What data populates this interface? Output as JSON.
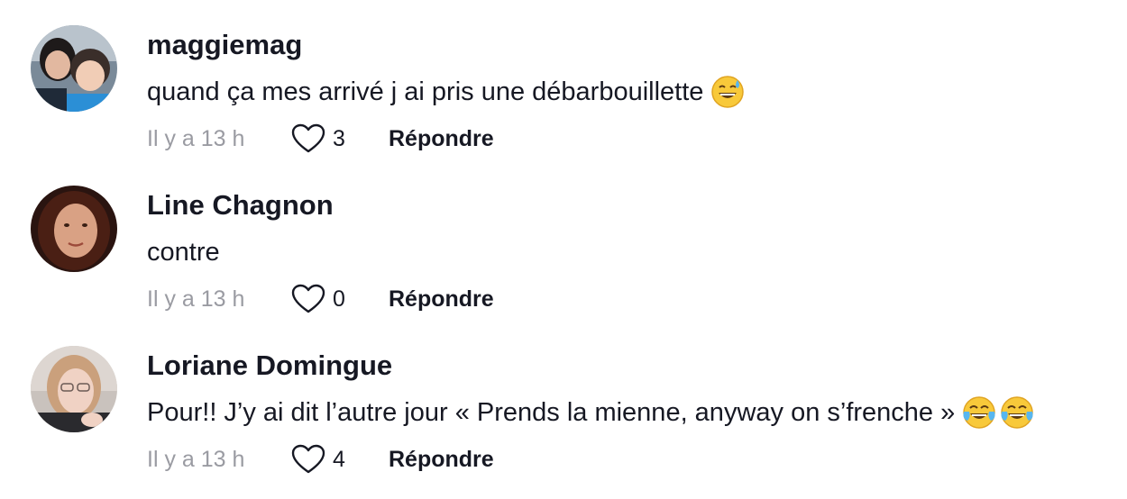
{
  "comments": [
    {
      "username": "maggiemag",
      "text": "quand ça mes arrivé j ai pris une débarbouillette",
      "emojis": [
        "grinning-sweat-emoji"
      ],
      "time": "Il y a 13 h",
      "likes": "3",
      "reply_label": "Répondre"
    },
    {
      "username": "Line Chagnon",
      "text": "contre",
      "emojis": [],
      "time": "Il y a 13 h",
      "likes": "0",
      "reply_label": "Répondre"
    },
    {
      "username": "Loriane Domingue",
      "text": "Pour!! J’y ai dit l’autre jour « Prends la mienne, anyway on s’frenche »",
      "emojis": [
        "tears-of-joy-emoji",
        "tears-of-joy-emoji"
      ],
      "time": "Il y a 13 h",
      "likes": "4",
      "reply_label": "Répondre"
    }
  ],
  "colors": {
    "text": "#161823",
    "muted": "#9a9ba2",
    "heart_outline": "#161823"
  }
}
